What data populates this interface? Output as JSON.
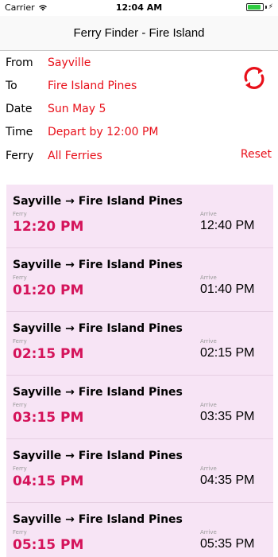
{
  "status_bar": {
    "carrier": "Carrier",
    "time": "12:04 AM",
    "battery_level": 0.9
  },
  "nav": {
    "title": "Ferry Finder - Fire Island"
  },
  "form": {
    "from_label": "From",
    "from_value": "Sayville",
    "to_label": "To",
    "to_value": "Fire Island Pines",
    "date_label": "Date",
    "date_value": "Sun May 5",
    "time_label": "Time",
    "time_value": "Depart by 12:00 PM",
    "ferry_label": "Ferry",
    "ferry_value": "All Ferries",
    "reset_label": "Reset",
    "accent_color": "#e8101a",
    "refresh_icon": "refresh-icon"
  },
  "trips": [
    {
      "route": "Sayville → Fire Island Pines",
      "ferry_label": "Ferry",
      "depart": "12:20 PM",
      "arrive_label": "Arrive",
      "arrive": "12:40 PM"
    },
    {
      "route": "Sayville → Fire Island Pines",
      "ferry_label": "Ferry",
      "depart": "01:20 PM",
      "arrive_label": "Arrive",
      "arrive": "01:40 PM"
    },
    {
      "route": "Sayville → Fire Island Pines",
      "ferry_label": "Ferry",
      "depart": "02:15 PM",
      "arrive_label": "Arrive",
      "arrive": "02:15 PM"
    },
    {
      "route": "Sayville → Fire Island Pines",
      "ferry_label": "Ferry",
      "depart": "03:15 PM",
      "arrive_label": "Arrive",
      "arrive": "03:35 PM"
    },
    {
      "route": "Sayville → Fire Island Pines",
      "ferry_label": "Ferry",
      "depart": "04:15 PM",
      "arrive_label": "Arrive",
      "arrive": "04:35 PM"
    },
    {
      "route": "Sayville → Fire Island Pines",
      "ferry_label": "Ferry",
      "depart": "05:15 PM",
      "arrive_label": "Arrive",
      "arrive": "05:35 PM"
    }
  ]
}
